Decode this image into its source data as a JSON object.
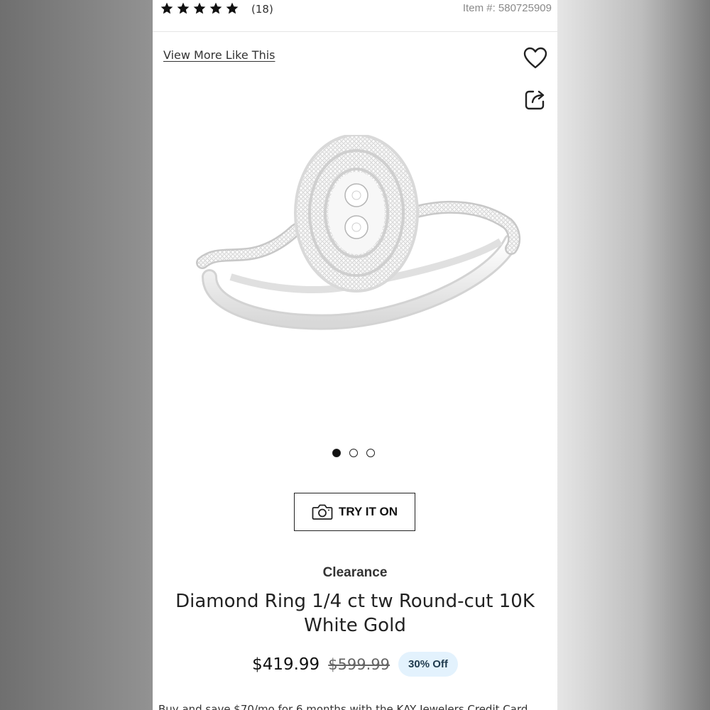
{
  "rating": {
    "stars": 5,
    "review_count": "(18)"
  },
  "item_number": "Item #: 580725909",
  "view_more_label": "View More Like This",
  "icons": {
    "favorite": "heart-icon",
    "share": "share-icon",
    "camera": "camera-icon"
  },
  "gallery": {
    "image": "diamond-ring-product-photo",
    "dot_count": 3,
    "active_index": 0
  },
  "try_on_label": "TRY IT ON",
  "product": {
    "tag": "Clearance",
    "title": "Diamond Ring 1/4 ct tw Round-cut 10K White Gold",
    "price": "$419.99",
    "original_price": "$599.99",
    "discount_badge": "30% Off"
  },
  "promo_text": "Buy and save $70/mo for 6 months with the KAY Jewelers Credit Card",
  "colors": {
    "badge_bg": "#e3f2fd",
    "text": "#222222"
  }
}
